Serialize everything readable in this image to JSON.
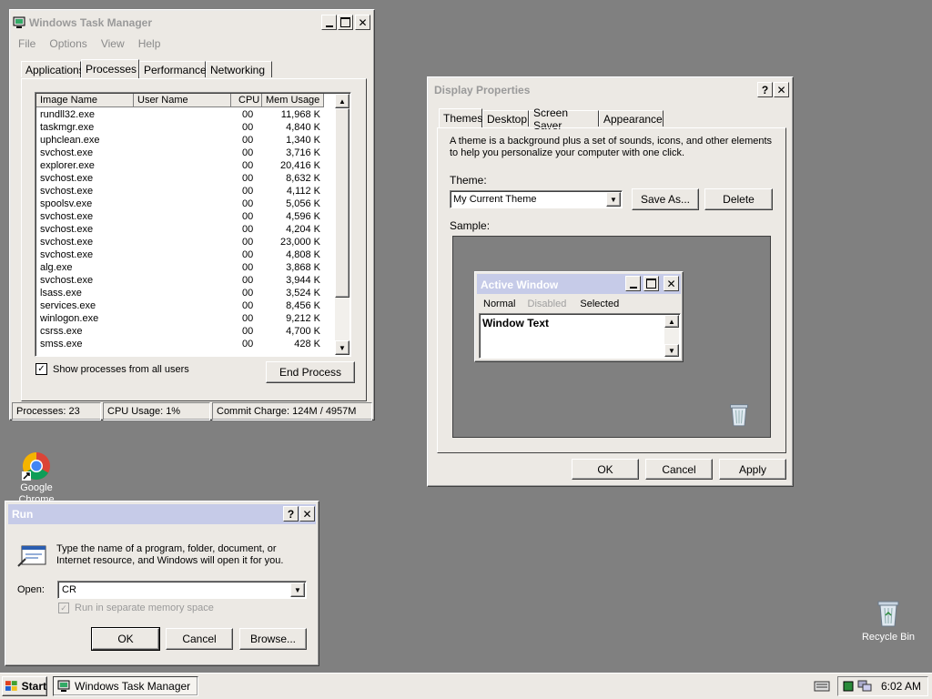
{
  "desktop": {
    "chrome_icon_label": "Google Chrome",
    "recycle_bin_label": "Recycle Bin"
  },
  "task_manager": {
    "title": "Windows Task Manager",
    "menu": [
      "File",
      "Options",
      "View",
      "Help"
    ],
    "tabs": [
      "Applications",
      "Processes",
      "Performance",
      "Networking"
    ],
    "active_tab": "Processes",
    "columns": [
      "Image Name",
      "User Name",
      "CPU",
      "Mem Usage"
    ],
    "processes": [
      {
        "name": "rundll32.exe",
        "user": "",
        "cpu": "00",
        "mem": "11,968 K"
      },
      {
        "name": "taskmgr.exe",
        "user": "",
        "cpu": "00",
        "mem": "4,840 K"
      },
      {
        "name": "uphclean.exe",
        "user": "",
        "cpu": "00",
        "mem": "1,340 K"
      },
      {
        "name": "svchost.exe",
        "user": "",
        "cpu": "00",
        "mem": "3,716 K"
      },
      {
        "name": "explorer.exe",
        "user": "",
        "cpu": "00",
        "mem": "20,416 K"
      },
      {
        "name": "svchost.exe",
        "user": "",
        "cpu": "00",
        "mem": "8,632 K"
      },
      {
        "name": "svchost.exe",
        "user": "",
        "cpu": "00",
        "mem": "4,112 K"
      },
      {
        "name": "spoolsv.exe",
        "user": "",
        "cpu": "00",
        "mem": "5,056 K"
      },
      {
        "name": "svchost.exe",
        "user": "",
        "cpu": "00",
        "mem": "4,596 K"
      },
      {
        "name": "svchost.exe",
        "user": "",
        "cpu": "00",
        "mem": "4,204 K"
      },
      {
        "name": "svchost.exe",
        "user": "",
        "cpu": "00",
        "mem": "23,000 K"
      },
      {
        "name": "svchost.exe",
        "user": "",
        "cpu": "00",
        "mem": "4,808 K"
      },
      {
        "name": "alg.exe",
        "user": "",
        "cpu": "00",
        "mem": "3,868 K"
      },
      {
        "name": "svchost.exe",
        "user": "",
        "cpu": "00",
        "mem": "3,944 K"
      },
      {
        "name": "lsass.exe",
        "user": "",
        "cpu": "00",
        "mem": "3,524 K"
      },
      {
        "name": "services.exe",
        "user": "",
        "cpu": "00",
        "mem": "8,456 K"
      },
      {
        "name": "winlogon.exe",
        "user": "",
        "cpu": "00",
        "mem": "9,212 K"
      },
      {
        "name": "csrss.exe",
        "user": "",
        "cpu": "00",
        "mem": "4,700 K"
      },
      {
        "name": "smss.exe",
        "user": "",
        "cpu": "00",
        "mem": "428 K"
      }
    ],
    "show_all_label": "Show processes from all users",
    "show_all_checked": true,
    "end_process_label": "End Process",
    "status": {
      "processes": "Processes: 23",
      "cpu": "CPU Usage: 1%",
      "commit": "Commit Charge: 124M / 4957M"
    }
  },
  "display_properties": {
    "title": "Display Properties",
    "tabs": [
      "Themes",
      "Desktop",
      "Screen Saver",
      "Appearance"
    ],
    "active_tab": "Themes",
    "description": "A theme is a background plus a set of sounds, icons, and other elements to help you personalize your computer with one click.",
    "theme_label": "Theme:",
    "theme_value": "My Current Theme",
    "save_as_label": "Save As...",
    "delete_label": "Delete",
    "sample_label": "Sample:",
    "sample": {
      "active_window_title": "Active Window",
      "menu": [
        "Normal",
        "Disabled",
        "Selected"
      ],
      "window_text": "Window Text"
    },
    "ok_label": "OK",
    "cancel_label": "Cancel",
    "apply_label": "Apply"
  },
  "run_dialog": {
    "title": "Run",
    "description": "Type the name of a program, folder, document, or Internet resource, and Windows will open it for you.",
    "open_label": "Open:",
    "open_value": "CR",
    "separate_memory_label": "Run in separate memory space",
    "ok_label": "OK",
    "cancel_label": "Cancel",
    "browse_label": "Browse..."
  },
  "taskbar": {
    "start_label": "Start",
    "task_button_label": "Windows Task Manager",
    "clock": "6:02 AM"
  }
}
